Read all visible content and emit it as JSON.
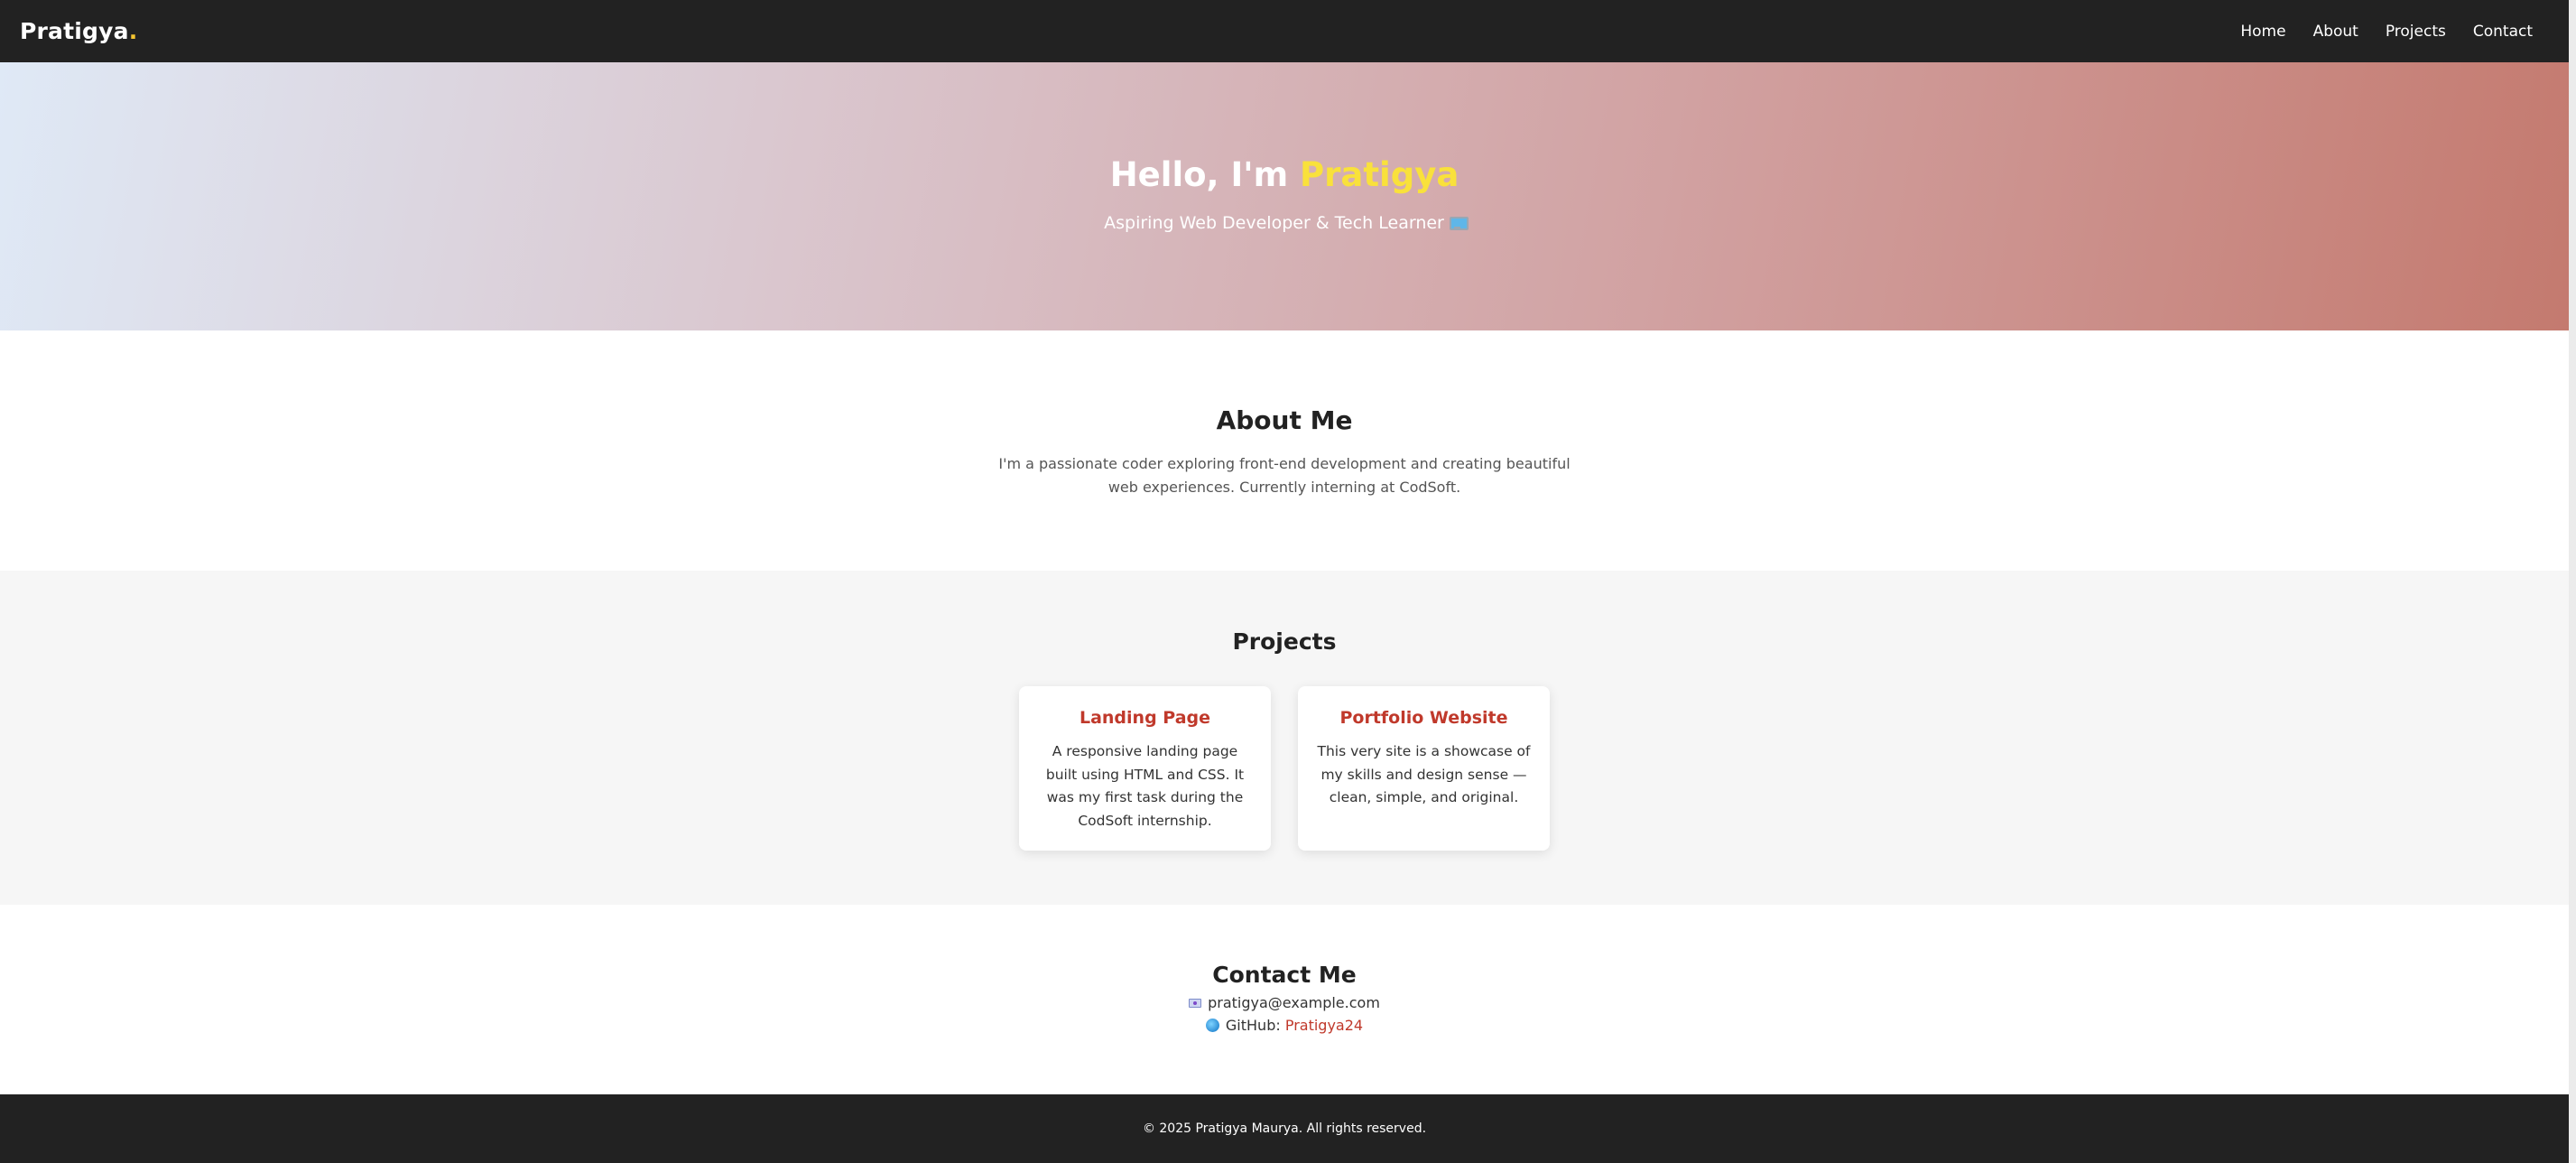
{
  "nav": {
    "brand": "Pratigya",
    "brand_dot": ".",
    "links": [
      "Home",
      "About",
      "Projects",
      "Contact"
    ]
  },
  "hero": {
    "greeting": "Hello, I'm ",
    "name": "Pratigya",
    "subtitle": "Aspiring Web Developer & Tech Learner",
    "subtitle_icon": "computer-icon"
  },
  "about": {
    "title": "About Me",
    "text": "I'm a passionate coder exploring front-end development and creating beautiful web experiences. Currently interning at CodSoft."
  },
  "projects": {
    "title": "Projects",
    "items": [
      {
        "title": "Landing Page",
        "description": "A responsive landing page built using HTML and CSS. It was my first task during the CodSoft internship."
      },
      {
        "title": "Portfolio Website",
        "description": "This very site is a showcase of my skills and design sense — clean, simple, and original."
      }
    ]
  },
  "contact": {
    "title": "Contact Me",
    "email": "pratigya@example.com",
    "github_label": "GitHub: ",
    "github_handle": "Pratigya24"
  },
  "footer": {
    "text": "© 2025 Pratigya Maurya. All rights reserved."
  },
  "colors": {
    "nav_bg": "#222222",
    "accent_yellow": "#f9e13b",
    "brand_dot": "#f4c430",
    "accent_red": "#c0392b",
    "projects_bg": "#f6f6f6"
  }
}
